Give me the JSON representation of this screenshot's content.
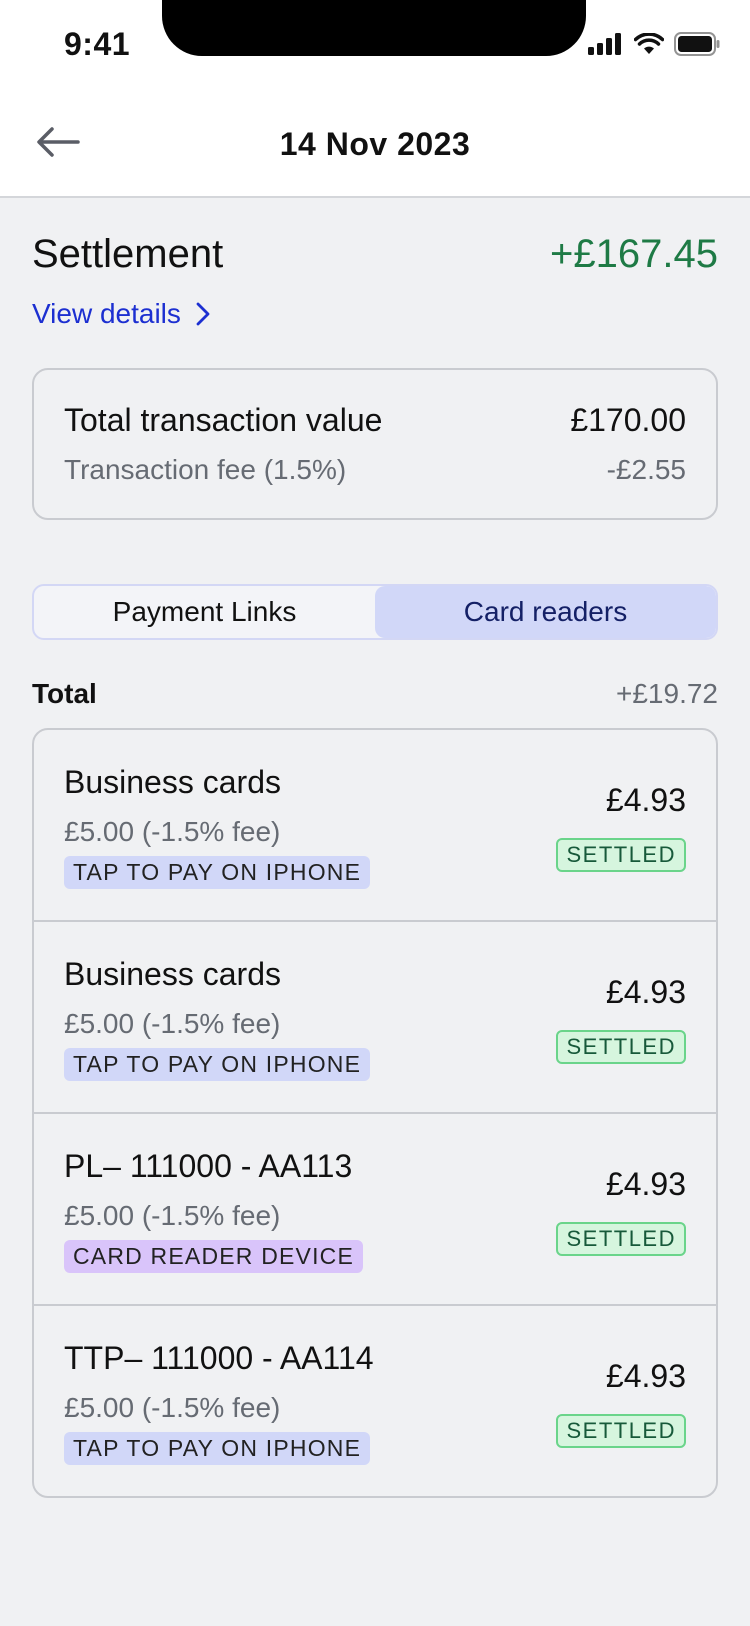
{
  "status_bar": {
    "time": "9:41"
  },
  "header": {
    "title": "14 Nov 2023"
  },
  "settlement": {
    "title": "Settlement",
    "amount": "+£167.45",
    "view_details_label": "View details"
  },
  "summary": {
    "total_label": "Total transaction value",
    "total_value": "£170.00",
    "fee_label": "Transaction fee (1.5%)",
    "fee_value": "-£2.55"
  },
  "tabs": [
    {
      "label": "Payment Links",
      "active": false
    },
    {
      "label": "Card readers",
      "active": true
    }
  ],
  "total": {
    "label": "Total",
    "value": "+£19.72"
  },
  "transactions": [
    {
      "title": "Business cards",
      "subtitle": "£5.00 (-1.5% fee)",
      "tag": "TAP TO PAY ON IPHONE",
      "amount": "£4.93",
      "status": "SETTLED"
    },
    {
      "title": "Business cards",
      "subtitle": "£5.00 (-1.5% fee)",
      "tag": "TAP TO PAY ON IPHONE",
      "amount": "£4.93",
      "status": "SETTLED"
    },
    {
      "title": "PL– 111000 - AA113",
      "subtitle": "£5.00 (-1.5% fee)",
      "tag": "CARD READER DEVICE",
      "amount": "£4.93",
      "status": "SETTLED"
    },
    {
      "title": "TTP– 111000 - AA114",
      "subtitle": "£5.00 (-1.5% fee)",
      "tag": "TAP TO PAY ON IPHONE",
      "amount": "£4.93",
      "status": "SETTLED"
    }
  ],
  "colors": {
    "positive": "#1e7a45",
    "link": "#1c2fd1",
    "tab_active_bg": "#d1d7f8",
    "tag_tap_to_pay": "#d1d7f8",
    "tag_card_reader": "#d9c4fa",
    "settled_badge_bg": "#d6f5de"
  }
}
